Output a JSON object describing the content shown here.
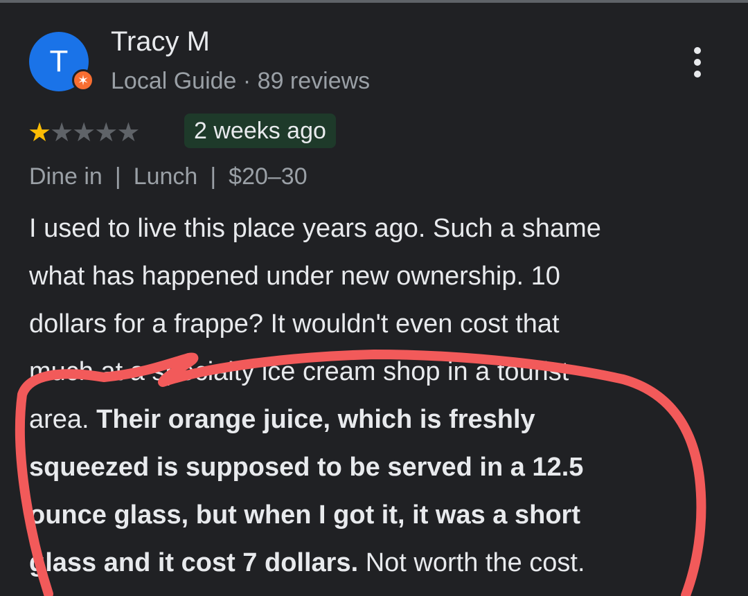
{
  "reviewer": {
    "initial": "T",
    "name": "Tracy M",
    "guide_line": "Local Guide · 89 reviews",
    "badge_icon": "local-guide-star-icon"
  },
  "review": {
    "rating": 1,
    "max_rating": 5,
    "time": "2 weeks ago",
    "tags": [
      "Dine in",
      "Lunch",
      "$20–30"
    ],
    "tag_separator": "|",
    "lines": [
      {
        "plain": "I used to live this place years ago. Such a shame"
      },
      {
        "plain": "what has happened under new ownership. 10"
      },
      {
        "plain": "dollars for a frappe? It wouldn't even cost that"
      },
      {
        "plain": "much at a specialty ice cream shop in a tourist"
      },
      {
        "plain": "area. ",
        "bold": "Their orange juice, which is freshly"
      },
      {
        "bold": "squeezed is supposed to be served in a 12.5"
      },
      {
        "bold": "ounce glass, but when I got it, it was a short"
      },
      {
        "bold": "glass and it cost 7 dollars.",
        "plain_after": " Not worth the cost."
      }
    ]
  },
  "colors": {
    "background": "#202124",
    "avatar": "#1a73e8",
    "guide_badge": "#f86e31",
    "star_filled": "#fbbc04",
    "star_empty": "#5f6368",
    "time_chip": "#1e3a2a",
    "annotation": "#f25a5a"
  },
  "icons": {
    "more": "more-vert-icon",
    "star": "star-icon"
  }
}
